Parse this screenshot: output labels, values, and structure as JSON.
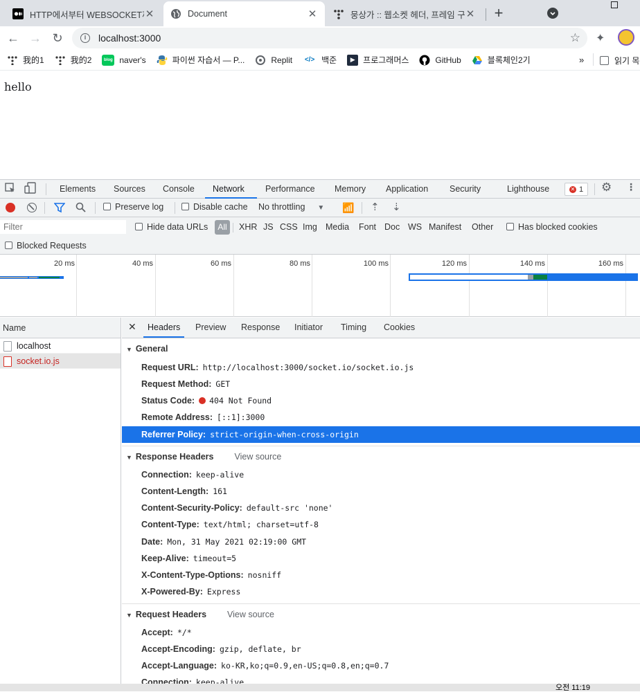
{
  "browser": {
    "tabs": [
      {
        "title": "HTTP에서부터 WEBSOCKET까지",
        "active": false,
        "icon": "medium-icon"
      },
      {
        "title": "Document",
        "active": true,
        "icon": "globe-icon"
      },
      {
        "title": "뭉상가 :: 웹소켓 헤더, 프레임 구",
        "active": false,
        "icon": "tistory-icon"
      }
    ],
    "new_tab": "+",
    "url": "localhost:3000",
    "bookmarks": [
      {
        "label": "我的1",
        "icon": "tistory-icon"
      },
      {
        "label": "我的2",
        "icon": "tistory-icon"
      },
      {
        "label": "naver's",
        "icon": "naver-blog-icon"
      },
      {
        "label": "파이썬 자습서 — P...",
        "icon": "python-icon"
      },
      {
        "label": "Replit",
        "icon": "replit-icon"
      },
      {
        "label": "백준",
        "icon": "code-icon"
      },
      {
        "label": "프로그래머스",
        "icon": "programmers-icon"
      },
      {
        "label": "GitHub",
        "icon": "github-icon"
      },
      {
        "label": "블록체인2기",
        "icon": "google-drive-icon"
      }
    ],
    "bookmarks_more": "»",
    "reading_list": "읽기 목"
  },
  "page": {
    "content": "hello"
  },
  "devtools": {
    "tabs": [
      "Elements",
      "Sources",
      "Console",
      "Network",
      "Performance",
      "Memory",
      "Application",
      "Security",
      "Lighthouse"
    ],
    "active_tab": "Network",
    "error_count": "1",
    "network_toolbar": {
      "preserve_log": "Preserve log",
      "disable_cache": "Disable cache",
      "throttling": "No throttling"
    },
    "filter": {
      "placeholder": "Filter",
      "hide_data_urls": "Hide data URLs",
      "types": [
        "All",
        "XHR",
        "JS",
        "CSS",
        "Img",
        "Media",
        "Font",
        "Doc",
        "WS",
        "Manifest",
        "Other"
      ],
      "has_blocked_cookies": "Has blocked cookies",
      "blocked_requests": "Blocked Requests"
    },
    "overview": {
      "ticks": [
        "20 ms",
        "40 ms",
        "60 ms",
        "80 ms",
        "100 ms",
        "120 ms",
        "140 ms",
        "160 ms"
      ]
    },
    "name_column": "Name",
    "requests": [
      {
        "name": "localhost",
        "selected": false,
        "error": false
      },
      {
        "name": "socket.io.js",
        "selected": true,
        "error": true
      }
    ],
    "detail_tabs": [
      "Headers",
      "Preview",
      "Response",
      "Initiator",
      "Timing",
      "Cookies"
    ],
    "detail_active": "Headers",
    "general": {
      "title": "General",
      "rows": [
        {
          "key": "Request URL:",
          "value": "http://localhost:3000/socket.io/socket.io.js"
        },
        {
          "key": "Request Method:",
          "value": "GET"
        },
        {
          "key": "Status Code:",
          "value": "404 Not Found"
        },
        {
          "key": "Remote Address:",
          "value": "[::1]:3000"
        },
        {
          "key": "Referrer Policy:",
          "value": "strict-origin-when-cross-origin"
        }
      ]
    },
    "response_headers": {
      "title": "Response Headers",
      "view_source": "View source",
      "rows": [
        {
          "key": "Connection:",
          "value": "keep-alive"
        },
        {
          "key": "Content-Length:",
          "value": "161"
        },
        {
          "key": "Content-Security-Policy:",
          "value": "default-src 'none'"
        },
        {
          "key": "Content-Type:",
          "value": "text/html; charset=utf-8"
        },
        {
          "key": "Date:",
          "value": "Mon, 31 May 2021 02:19:00 GMT"
        },
        {
          "key": "Keep-Alive:",
          "value": "timeout=5"
        },
        {
          "key": "X-Content-Type-Options:",
          "value": "nosniff"
        },
        {
          "key": "X-Powered-By:",
          "value": "Express"
        }
      ]
    },
    "request_headers": {
      "title": "Request Headers",
      "view_source": "View source",
      "rows": [
        {
          "key": "Accept:",
          "value": "*/*"
        },
        {
          "key": "Accept-Encoding:",
          "value": "gzip, deflate, br"
        },
        {
          "key": "Accept-Language:",
          "value": "ko-KR,ko;q=0.9,en-US;q=0.8,en;q=0.7"
        },
        {
          "key": "Connection:",
          "value": "keep-alive"
        }
      ]
    }
  },
  "taskbar": {
    "clock": "오전 11:19"
  },
  "colors": {
    "accent": "#1a73e8",
    "error": "#d93025"
  }
}
